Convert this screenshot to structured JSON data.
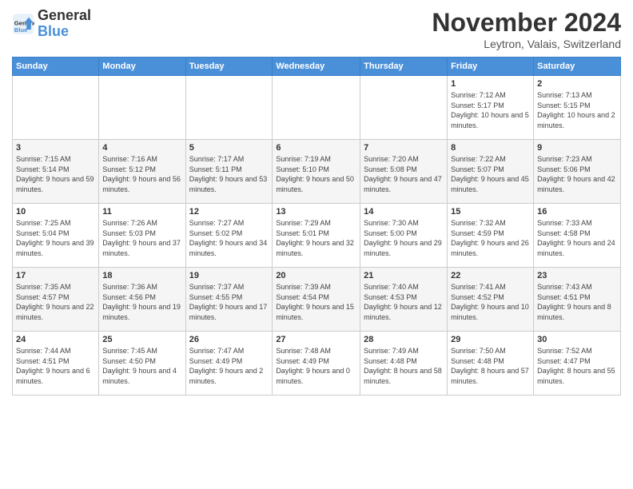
{
  "header": {
    "logo_line1": "General",
    "logo_line2": "Blue",
    "month": "November 2024",
    "location": "Leytron, Valais, Switzerland"
  },
  "days_of_week": [
    "Sunday",
    "Monday",
    "Tuesday",
    "Wednesday",
    "Thursday",
    "Friday",
    "Saturday"
  ],
  "weeks": [
    [
      {
        "day": "",
        "info": ""
      },
      {
        "day": "",
        "info": ""
      },
      {
        "day": "",
        "info": ""
      },
      {
        "day": "",
        "info": ""
      },
      {
        "day": "",
        "info": ""
      },
      {
        "day": "1",
        "info": "Sunrise: 7:12 AM\nSunset: 5:17 PM\nDaylight: 10 hours and 5 minutes."
      },
      {
        "day": "2",
        "info": "Sunrise: 7:13 AM\nSunset: 5:15 PM\nDaylight: 10 hours and 2 minutes."
      }
    ],
    [
      {
        "day": "3",
        "info": "Sunrise: 7:15 AM\nSunset: 5:14 PM\nDaylight: 9 hours and 59 minutes."
      },
      {
        "day": "4",
        "info": "Sunrise: 7:16 AM\nSunset: 5:12 PM\nDaylight: 9 hours and 56 minutes."
      },
      {
        "day": "5",
        "info": "Sunrise: 7:17 AM\nSunset: 5:11 PM\nDaylight: 9 hours and 53 minutes."
      },
      {
        "day": "6",
        "info": "Sunrise: 7:19 AM\nSunset: 5:10 PM\nDaylight: 9 hours and 50 minutes."
      },
      {
        "day": "7",
        "info": "Sunrise: 7:20 AM\nSunset: 5:08 PM\nDaylight: 9 hours and 47 minutes."
      },
      {
        "day": "8",
        "info": "Sunrise: 7:22 AM\nSunset: 5:07 PM\nDaylight: 9 hours and 45 minutes."
      },
      {
        "day": "9",
        "info": "Sunrise: 7:23 AM\nSunset: 5:06 PM\nDaylight: 9 hours and 42 minutes."
      }
    ],
    [
      {
        "day": "10",
        "info": "Sunrise: 7:25 AM\nSunset: 5:04 PM\nDaylight: 9 hours and 39 minutes."
      },
      {
        "day": "11",
        "info": "Sunrise: 7:26 AM\nSunset: 5:03 PM\nDaylight: 9 hours and 37 minutes."
      },
      {
        "day": "12",
        "info": "Sunrise: 7:27 AM\nSunset: 5:02 PM\nDaylight: 9 hours and 34 minutes."
      },
      {
        "day": "13",
        "info": "Sunrise: 7:29 AM\nSunset: 5:01 PM\nDaylight: 9 hours and 32 minutes."
      },
      {
        "day": "14",
        "info": "Sunrise: 7:30 AM\nSunset: 5:00 PM\nDaylight: 9 hours and 29 minutes."
      },
      {
        "day": "15",
        "info": "Sunrise: 7:32 AM\nSunset: 4:59 PM\nDaylight: 9 hours and 26 minutes."
      },
      {
        "day": "16",
        "info": "Sunrise: 7:33 AM\nSunset: 4:58 PM\nDaylight: 9 hours and 24 minutes."
      }
    ],
    [
      {
        "day": "17",
        "info": "Sunrise: 7:35 AM\nSunset: 4:57 PM\nDaylight: 9 hours and 22 minutes."
      },
      {
        "day": "18",
        "info": "Sunrise: 7:36 AM\nSunset: 4:56 PM\nDaylight: 9 hours and 19 minutes."
      },
      {
        "day": "19",
        "info": "Sunrise: 7:37 AM\nSunset: 4:55 PM\nDaylight: 9 hours and 17 minutes."
      },
      {
        "day": "20",
        "info": "Sunrise: 7:39 AM\nSunset: 4:54 PM\nDaylight: 9 hours and 15 minutes."
      },
      {
        "day": "21",
        "info": "Sunrise: 7:40 AM\nSunset: 4:53 PM\nDaylight: 9 hours and 12 minutes."
      },
      {
        "day": "22",
        "info": "Sunrise: 7:41 AM\nSunset: 4:52 PM\nDaylight: 9 hours and 10 minutes."
      },
      {
        "day": "23",
        "info": "Sunrise: 7:43 AM\nSunset: 4:51 PM\nDaylight: 9 hours and 8 minutes."
      }
    ],
    [
      {
        "day": "24",
        "info": "Sunrise: 7:44 AM\nSunset: 4:51 PM\nDaylight: 9 hours and 6 minutes."
      },
      {
        "day": "25",
        "info": "Sunrise: 7:45 AM\nSunset: 4:50 PM\nDaylight: 9 hours and 4 minutes."
      },
      {
        "day": "26",
        "info": "Sunrise: 7:47 AM\nSunset: 4:49 PM\nDaylight: 9 hours and 2 minutes."
      },
      {
        "day": "27",
        "info": "Sunrise: 7:48 AM\nSunset: 4:49 PM\nDaylight: 9 hours and 0 minutes."
      },
      {
        "day": "28",
        "info": "Sunrise: 7:49 AM\nSunset: 4:48 PM\nDaylight: 8 hours and 58 minutes."
      },
      {
        "day": "29",
        "info": "Sunrise: 7:50 AM\nSunset: 4:48 PM\nDaylight: 8 hours and 57 minutes."
      },
      {
        "day": "30",
        "info": "Sunrise: 7:52 AM\nSunset: 4:47 PM\nDaylight: 8 hours and 55 minutes."
      }
    ]
  ]
}
